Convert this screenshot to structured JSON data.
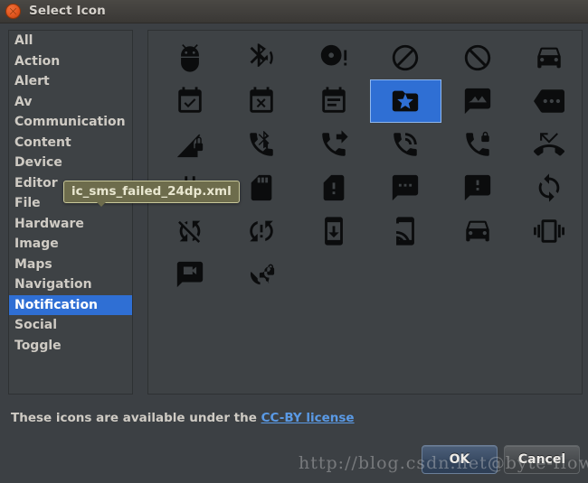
{
  "window": {
    "title": "Select Icon",
    "close_icon": "close-icon"
  },
  "categories": {
    "selected": "Notification",
    "items": [
      {
        "label": "All"
      },
      {
        "label": "Action"
      },
      {
        "label": "Alert"
      },
      {
        "label": "Av"
      },
      {
        "label": "Communication"
      },
      {
        "label": "Content"
      },
      {
        "label": "Device"
      },
      {
        "label": "Editor"
      },
      {
        "label": "File"
      },
      {
        "label": "Hardware"
      },
      {
        "label": "Image"
      },
      {
        "label": "Maps"
      },
      {
        "label": "Navigation"
      },
      {
        "label": "Notification"
      },
      {
        "label": "Social"
      },
      {
        "label": "Toggle"
      }
    ]
  },
  "icons": {
    "selected_index": 9,
    "items": [
      {
        "name": "adb-icon"
      },
      {
        "name": "bluetooth-audio-icon"
      },
      {
        "name": "disc-full-icon"
      },
      {
        "name": "do-not-disturb-alt-icon"
      },
      {
        "name": "do-not-disturb-icon"
      },
      {
        "name": "drive-eta-icon"
      },
      {
        "name": "event-available-icon"
      },
      {
        "name": "event-busy-icon"
      },
      {
        "name": "event-note-icon"
      },
      {
        "name": "folder-special-icon"
      },
      {
        "name": "mms-icon"
      },
      {
        "name": "more-icon"
      },
      {
        "name": "network-locked-icon"
      },
      {
        "name": "phone-bluetooth-speaker-icon"
      },
      {
        "name": "phone-forwarded-icon"
      },
      {
        "name": "phone-in-talk-icon"
      },
      {
        "name": "phone-locked-icon"
      },
      {
        "name": "phone-missed-icon"
      },
      {
        "name": "power-icon"
      },
      {
        "name": "sd-card-icon"
      },
      {
        "name": "sim-card-alert-icon"
      },
      {
        "name": "sms-icon"
      },
      {
        "name": "sms-failed-icon"
      },
      {
        "name": "sync-icon"
      },
      {
        "name": "sync-disabled-icon"
      },
      {
        "name": "sync-problem-icon"
      },
      {
        "name": "system-update-icon"
      },
      {
        "name": "tap-and-play-icon"
      },
      {
        "name": "time-to-leave-icon"
      },
      {
        "name": "vibration-icon"
      },
      {
        "name": "voice-chat-icon"
      },
      {
        "name": "vpn-lock-icon"
      }
    ]
  },
  "tooltip": {
    "text": "ic_sms_failed_24dp.xml"
  },
  "footer": {
    "license_text": "These icons are available under the ",
    "license_link": "CC-BY license"
  },
  "buttons": {
    "ok": "OK",
    "cancel": "Cancel"
  },
  "watermark": {
    "text": "http://blog.csdn.net@byte-flow"
  },
  "colors": {
    "accent": "#2f6fd4",
    "panel": "#3e4245",
    "window": "#3c4044",
    "link": "#5a9ae6",
    "tooltip_bg": "#6d6c4c",
    "close_button": "#e2561f"
  }
}
